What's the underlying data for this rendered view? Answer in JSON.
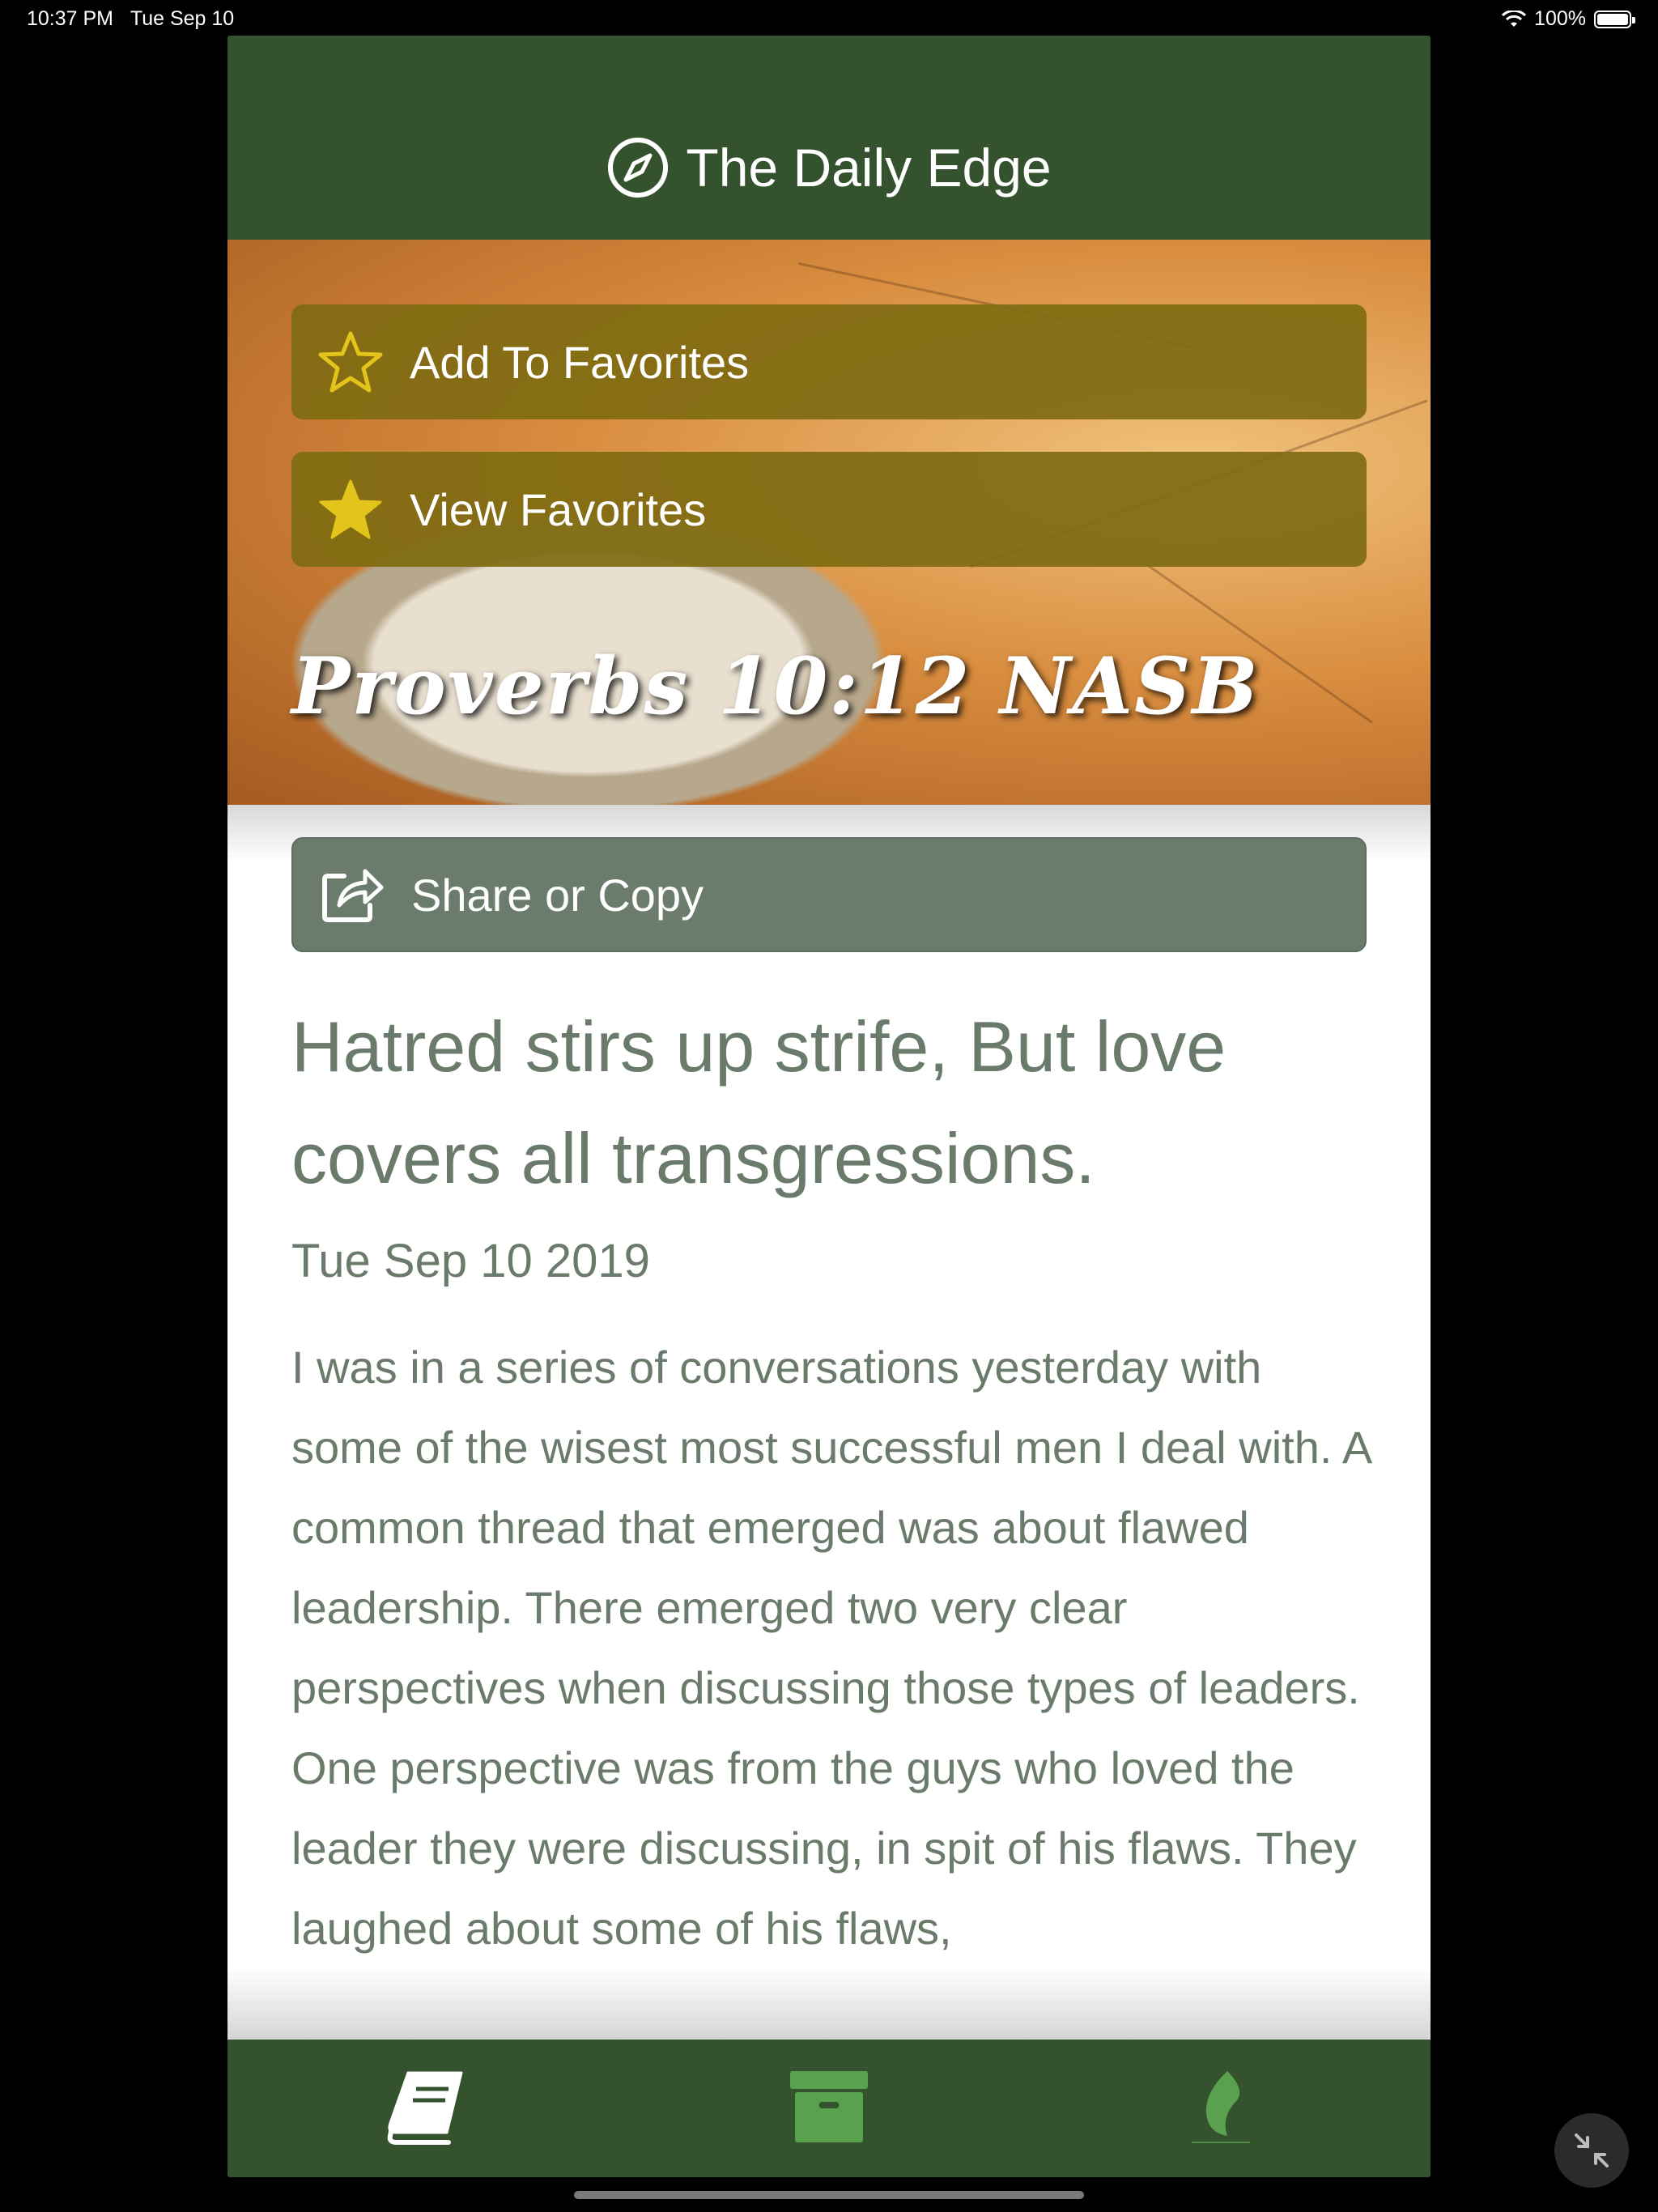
{
  "status_bar": {
    "time": "10:37 PM",
    "date": "Tue Sep 10",
    "battery": "100%",
    "battery_level": 1.0
  },
  "header": {
    "title": "The Daily Edge",
    "icon": "compass-icon"
  },
  "hero": {
    "add_favorites_label": "Add To Favorites",
    "view_favorites_label": "View Favorites",
    "reference": "Proverbs 10:12 NASB"
  },
  "content": {
    "share_label": "Share or Copy",
    "verse": "Hatred stirs up strife, But love covers all transgressions.",
    "date": "Tue Sep 10 2019",
    "body": "I was in a series of conversations yesterday with some of the wisest most successful men I deal with. A common thread that emerged was about flawed leadership. There emerged two very clear perspectives when discussing those types of leaders. One perspective was from the guys who loved the leader they were discussing, in spit of his flaws. They laughed about some of his flaws,"
  },
  "tabbar": {
    "tabs": [
      "book-icon",
      "archive-icon",
      "flame-icon"
    ]
  },
  "colors": {
    "header": "#34522d",
    "gold_button": "#806c12",
    "share_button": "#6b7c6c",
    "text": "#6a7a6b",
    "star": "#e3c41a"
  }
}
